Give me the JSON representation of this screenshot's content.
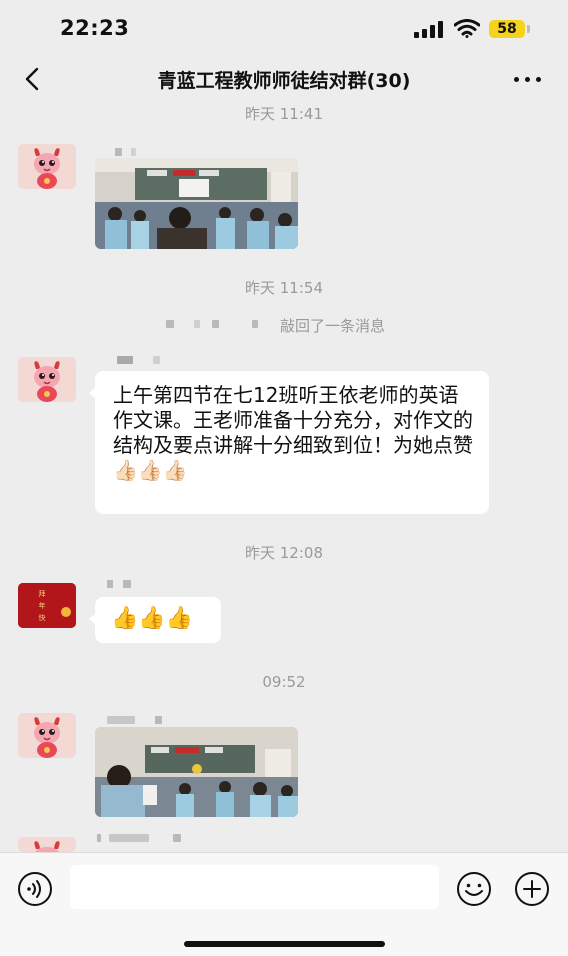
{
  "status": {
    "time": "22:23",
    "battery": "58"
  },
  "nav": {
    "title": "青蓝工程教师师徒结对群(30)"
  },
  "messages": {
    "ts1": "昨天 11:41",
    "ts2": "昨天 11:54",
    "recall_text": "敲回了一条消息",
    "text_message": "上午第四节在七12班听王依老师的英语作文课。王老师准备十分充分，对作文的结构及要点讲解十分细致到位！为她点赞",
    "text_emojis": "👍🏻👍🏻👍🏻",
    "ts3": "昨天 12:08",
    "thumbs_message": "👍👍👍",
    "ts4": "09:52",
    "avatar_red_text": "拜 年 快 乐"
  },
  "input": {
    "placeholder": ""
  },
  "icons": [
    "back-icon",
    "more-icon",
    "voice-icon",
    "emoji-icon",
    "plus-icon"
  ],
  "colors": {
    "background": "#ededed",
    "bubble": "#ffffff",
    "battery": "#f5d31d",
    "avatar_red": "#b3161a"
  }
}
